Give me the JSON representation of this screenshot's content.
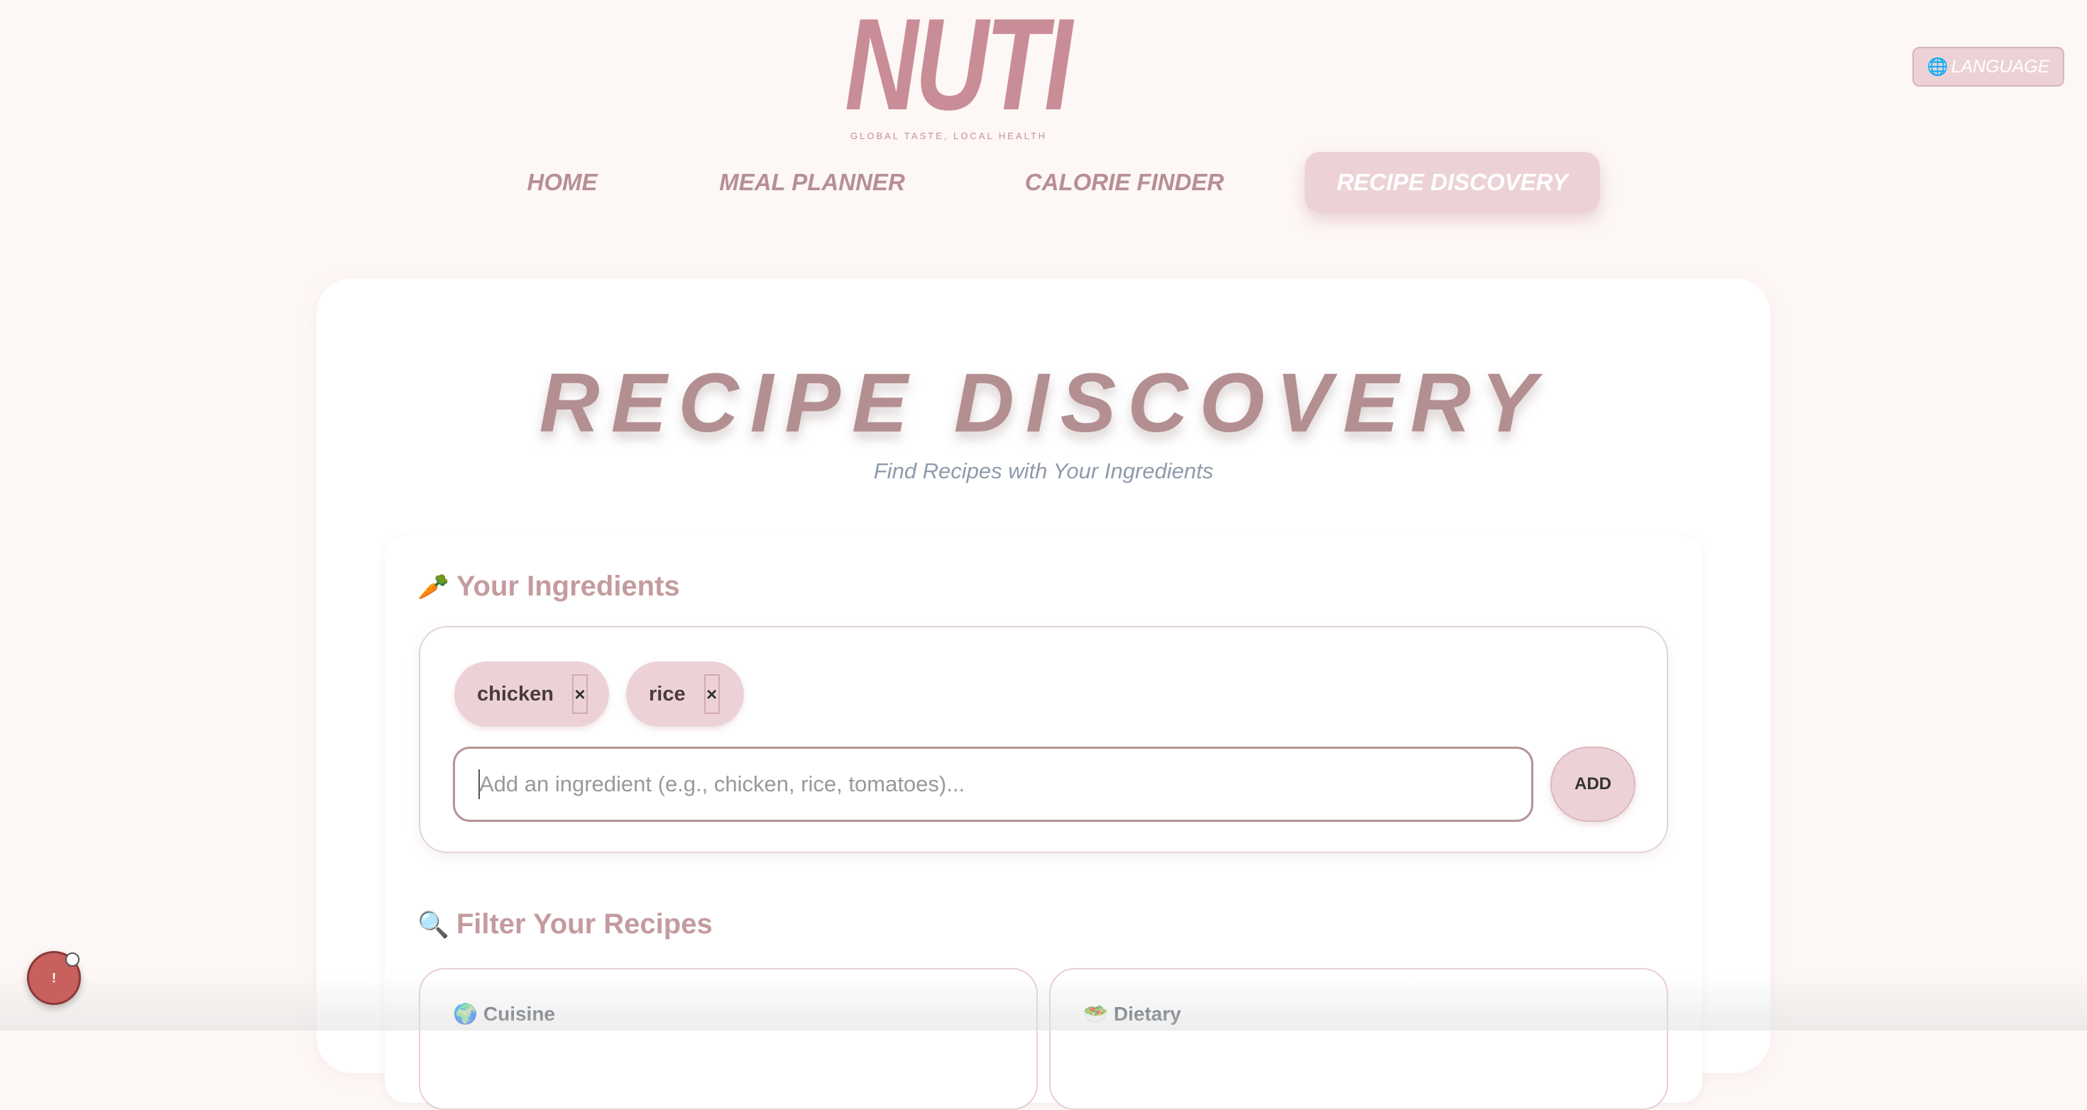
{
  "header": {
    "logo": "NUTI",
    "tagline": "GLOBAL TASTE, LOCAL HEALTH",
    "language_icon": "globe-icon",
    "language_glyph": "🌐",
    "language_label": "LANGUAGE"
  },
  "nav": {
    "items": [
      {
        "label": "HOME"
      },
      {
        "label": "MEAL PLANNER"
      },
      {
        "label": "CALORIE FINDER"
      },
      {
        "label": "RECIPE DISCOVERY",
        "active": true
      }
    ]
  },
  "page": {
    "title": "RECIPE DISCOVERY",
    "subtitle": "Find Recipes with Your Ingredients"
  },
  "ingredients": {
    "heading_icon": "🥕",
    "heading": "Your Ingredients",
    "chips": [
      {
        "label": "chicken",
        "remove": "×"
      },
      {
        "label": "rice",
        "remove": "×"
      }
    ],
    "input_value": "",
    "placeholder": "Add an ingredient (e.g., chicken, rice, tomatoes)...",
    "add_label": "ADD"
  },
  "filters": {
    "heading_icon": "🔍",
    "heading": "Filter Your Recipes",
    "cuisine_icon": "🌍",
    "cuisine_label": "Cuisine",
    "dietary_icon": "🥗",
    "dietary_label": "Dietary"
  },
  "fab": {
    "label": "!"
  },
  "colors": {
    "background": "#fdf7f5",
    "accent_pink": "#ecd2d7",
    "logo_pink": "#c98d98",
    "title_mauve": "#b38f92",
    "fab_red": "#c8605e"
  }
}
